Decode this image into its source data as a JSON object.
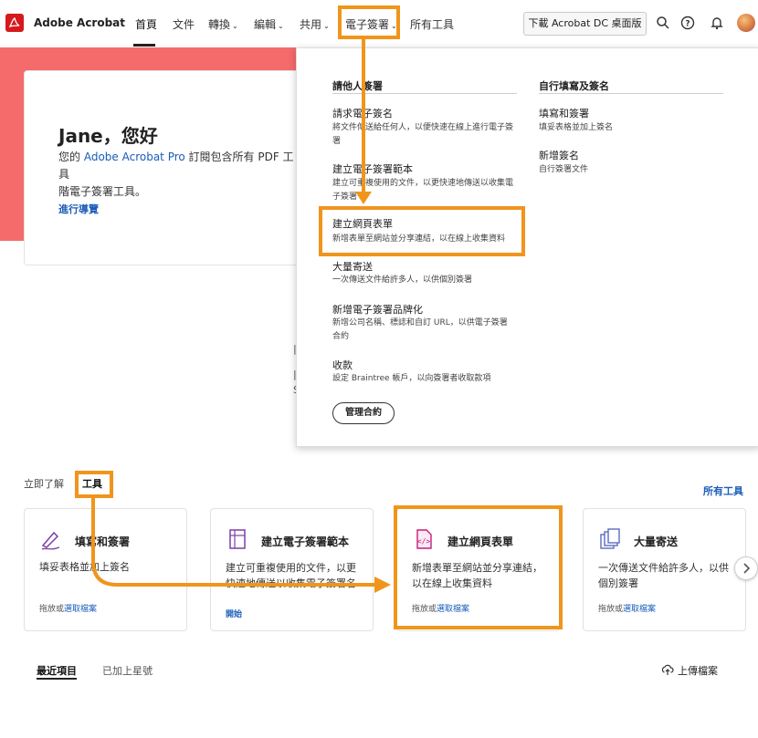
{
  "header": {
    "app_title": "Adobe Acrobat",
    "nav": [
      {
        "label": "首頁"
      },
      {
        "label": "文件"
      },
      {
        "label": "轉換"
      },
      {
        "label": "編輯"
      },
      {
        "label": "共用"
      },
      {
        "label": "電子簽署"
      },
      {
        "label": "所有工具"
      }
    ],
    "download_label": "下載 Acrobat DC 桌面版"
  },
  "hero": {
    "title": "Jane，您好",
    "text_before": "您的 ",
    "text_link": "Adobe Acrobat Pro",
    "text_after": " 訂閱包含所有 PDF 工具",
    "text_line2": "階電子簽署工具。",
    "tour_link": "進行導覽"
  },
  "dropdown": {
    "col1_heading": "請他人簽署",
    "col2_heading": "自行填寫及簽名",
    "col1_items": [
      {
        "title": "請求電子簽名",
        "desc": "將文件傳送給任何人，以便快速在線上進行電子簽署"
      },
      {
        "title": "建立電子簽署範本",
        "desc": "建立可重複使用的文件，以更快速地傳送以收集電子簽署"
      },
      {
        "title": "建立網頁表單",
        "desc": "新增表單至網站並分享連結，以在線上收集資料"
      },
      {
        "title": "大量寄送",
        "desc": "一次傳送文件給許多人，以供個別簽署"
      },
      {
        "title": "新增電子簽署品牌化",
        "desc": "新增公司名稱、標誌和自訂 URL，以供電子簽署合約"
      },
      {
        "title": "收款",
        "desc": "設定 Braintree 帳戶，以向簽署者收取款項"
      }
    ],
    "col2_items": [
      {
        "title": "填寫和簽署",
        "desc": "填妥表格並加上簽名"
      },
      {
        "title": "新增簽名",
        "desc": "自行簽署文件"
      }
    ],
    "manage_button": "管理合約"
  },
  "tools_section": {
    "tab_learn": "立即了解",
    "tab_tools": "工具",
    "all_tools_link": "所有工具",
    "cards": [
      {
        "title": "填寫和簽署",
        "desc": "填妥表格並加上簽名",
        "foot_text": "拖放或",
        "foot_link": "選取檔案",
        "icon": "pen-sign-icon"
      },
      {
        "title": "建立電子簽署範本",
        "desc": "建立可重複使用的文件，以更快速地傳送以收集電子簽署名",
        "start_link": "開始",
        "icon": "template-icon"
      },
      {
        "title": "建立網頁表單",
        "desc": "新增表單至網站並分享連結，以在線上收集資料",
        "foot_text": "拖放或",
        "foot_link": "選取檔案",
        "icon": "web-form-icon"
      },
      {
        "title": "大量寄送",
        "desc": "一次傳送文件給許多人，以供個別簽署",
        "foot_text": "拖放或",
        "foot_link": "選取檔案",
        "icon": "bulk-send-icon"
      }
    ]
  },
  "recent": {
    "tab_recent": "最近項目",
    "tab_starred": "已加上星號",
    "upload_label": "上傳檔案"
  },
  "colors": {
    "accent_orange": "#f0951c",
    "hero_red": "#f56b6b",
    "link_blue": "#1a5cb8",
    "adobe_red": "#d6191c"
  }
}
